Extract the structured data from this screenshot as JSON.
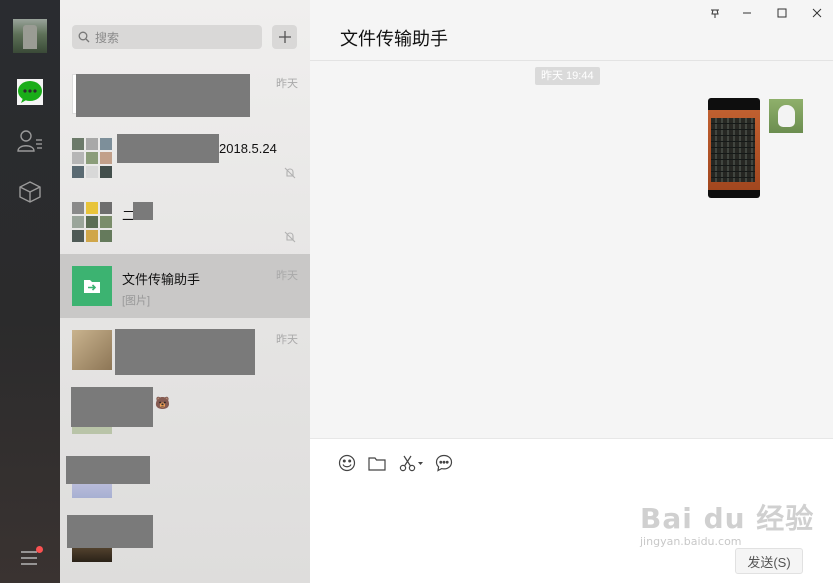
{
  "nav": {
    "items": [
      "avatar",
      "chat-icon",
      "contacts-icon",
      "box-icon"
    ],
    "accent": "#1aad19",
    "menu_badge": true
  },
  "search": {
    "placeholder": "搜索"
  },
  "conversations": [
    {
      "name": "",
      "time": "昨天",
      "muted": false,
      "selected": false,
      "redacted": true
    },
    {
      "name": "2018.5.24",
      "time": "",
      "muted": true,
      "selected": false,
      "redacted": true
    },
    {
      "name": "二",
      "time": "",
      "muted": true,
      "selected": false,
      "redacted": true
    },
    {
      "name": "文件传输助手",
      "preview": "[图片]",
      "time": "昨天",
      "muted": false,
      "selected": true,
      "redacted": false
    },
    {
      "name": "",
      "time": "昨天",
      "muted": false,
      "selected": false,
      "redacted": true
    },
    {
      "name": "",
      "time": "",
      "muted": false,
      "selected": false,
      "redacted": true
    },
    {
      "name": "",
      "time": "",
      "muted": false,
      "selected": false,
      "redacted": true
    },
    {
      "name": "",
      "time": "",
      "muted": false,
      "selected": false,
      "redacted": true
    }
  ],
  "chat": {
    "title": "文件传输助手",
    "timestamp": "昨天 19:44",
    "window_controls": [
      "pin-icon",
      "minimize-icon",
      "maximize-icon",
      "close-icon"
    ]
  },
  "input": {
    "tools": [
      "emoji-icon",
      "folder-icon",
      "scissors-icon",
      "chat-bubble-icon"
    ],
    "send_label": "发送(S)"
  },
  "watermark": {
    "brand": "Bai du 经验",
    "url": "jingyan.baidu.com"
  }
}
